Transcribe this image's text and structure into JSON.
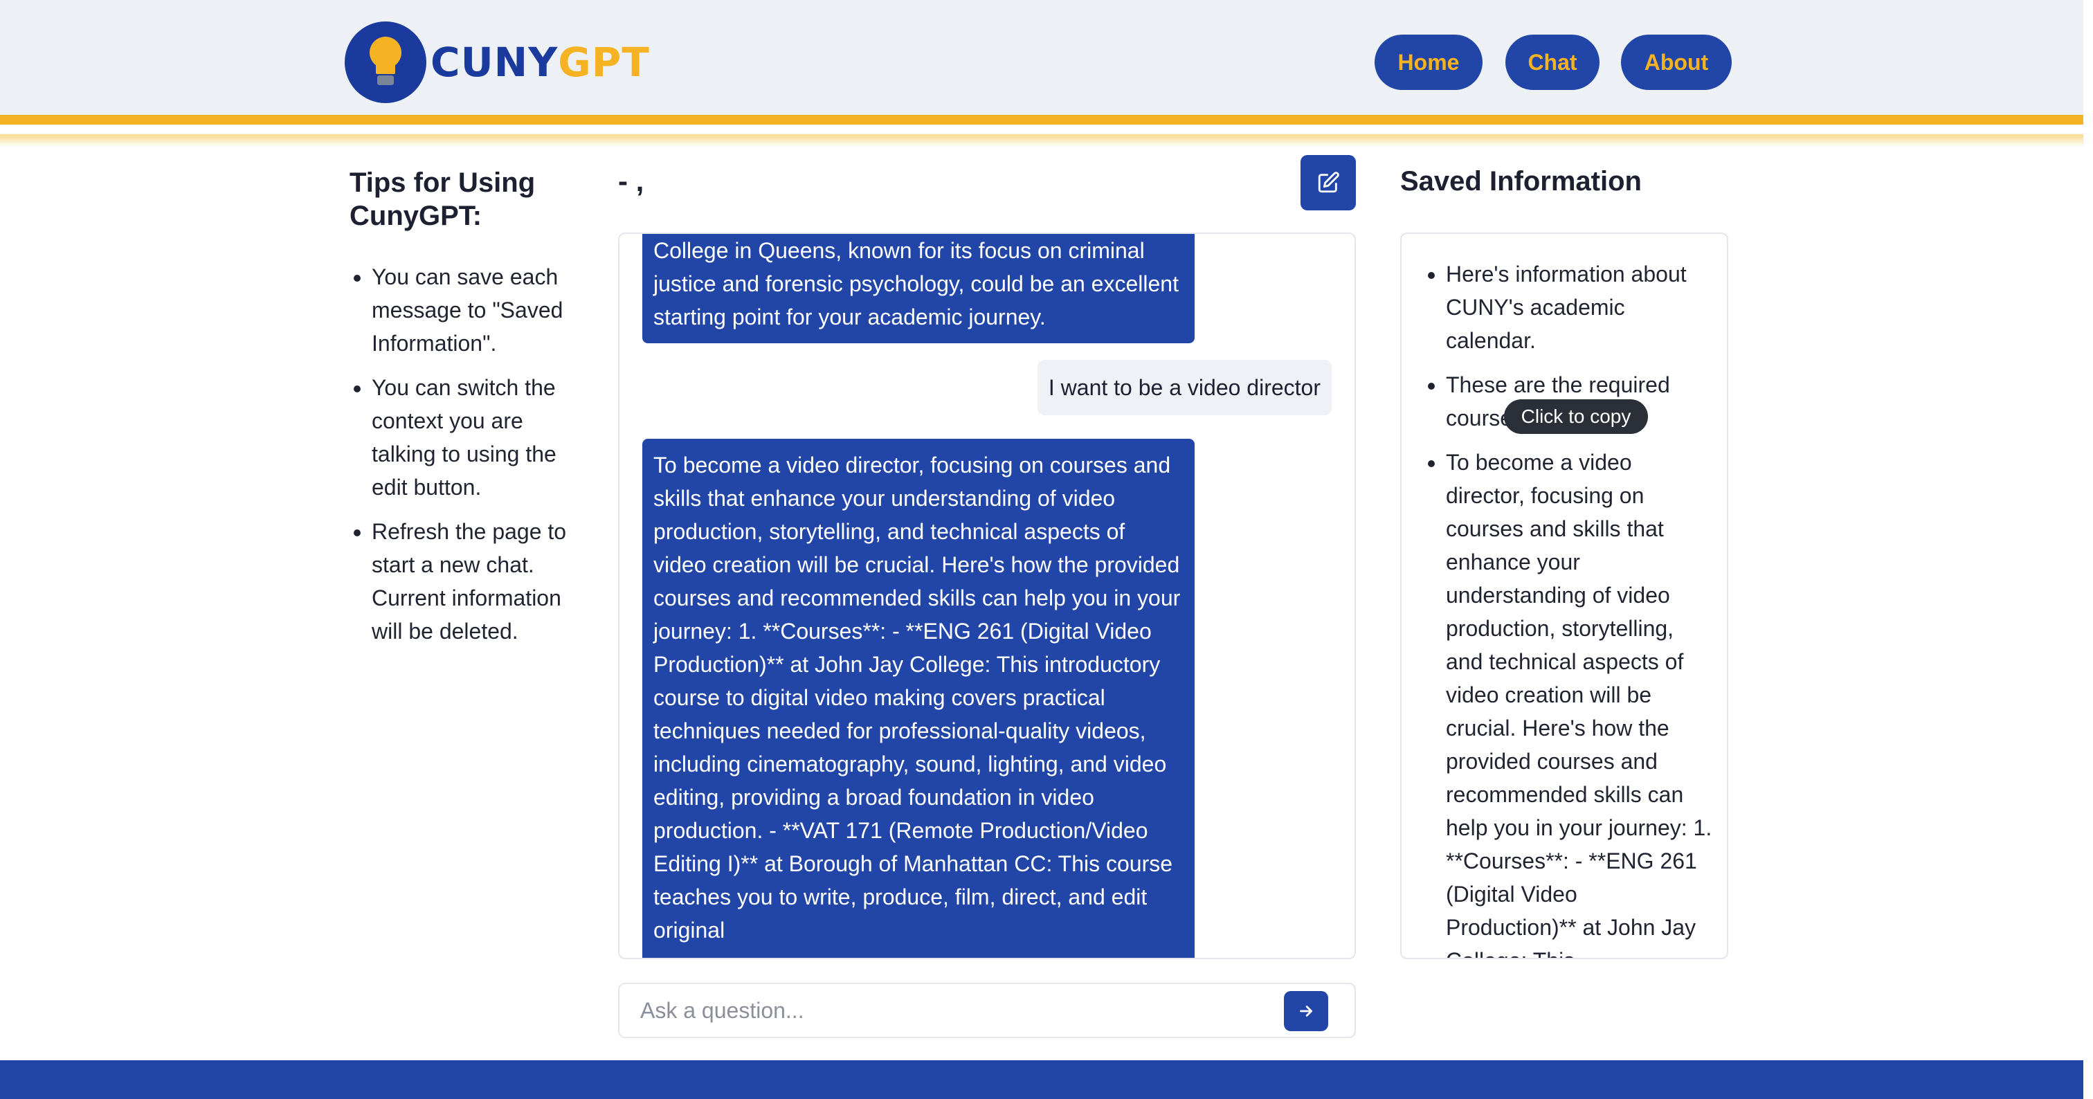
{
  "app": {
    "logo_cuny": "CUNY",
    "logo_gpt": "GPT"
  },
  "nav": {
    "home": "Home",
    "chat": "Chat",
    "about": "About"
  },
  "colors": {
    "brand_blue": "#2146a8",
    "accent_gold": "#f5b324",
    "header_bg": "#edf1f6"
  },
  "tips": {
    "title": "Tips for Using CunyGPT:",
    "items": [
      "You can save each message to \"Saved Information\".",
      "You can switch the context you are talking to using the edit button.",
      "Refresh the page to start a new chat. Current information will be deleted."
    ]
  },
  "chat": {
    "title": "- ,",
    "edit_icon": "edit-icon",
    "messages": [
      {
        "role": "bot",
        "text": "College in Queens, known for its focus on criminal justice and forensic psychology, could be an excellent starting point for your academic journey."
      },
      {
        "role": "user",
        "text": "I want to be a video director"
      },
      {
        "role": "bot",
        "text": "To become a video director, focusing on courses and skills that enhance your understanding of video production, storytelling, and technical aspects of video creation will be crucial. Here's how the provided courses and recommended skills can help you in your journey: 1. **Courses**: - **ENG 261 (Digital Video Production)** at John Jay College: This introductory course to digital video making covers practical techniques needed for professional-quality videos, including cinematography, sound, lighting, and video editing, providing a broad foundation in video production. - **VAT 171 (Remote Production/Video Editing I)** at Borough of Manhattan CC: This course teaches you to write, produce, film, direct, and edit original"
      }
    ],
    "input_placeholder": "Ask a question...",
    "send_icon": "arrow-right-icon"
  },
  "saved": {
    "title": "Saved Information",
    "items": [
      "Here's information about CUNY's academic calendar.",
      "These are the required courses for a major.",
      "To become a video director, focusing on courses and skills that enhance your understanding of video production, storytelling, and technical aspects of video creation will be crucial. Here's how the provided courses and recommended skills can help you in your journey: 1. **Courses**: - **ENG 261 (Digital Video Production)** at John Jay College: This"
    ],
    "tooltip": "Click to copy"
  }
}
